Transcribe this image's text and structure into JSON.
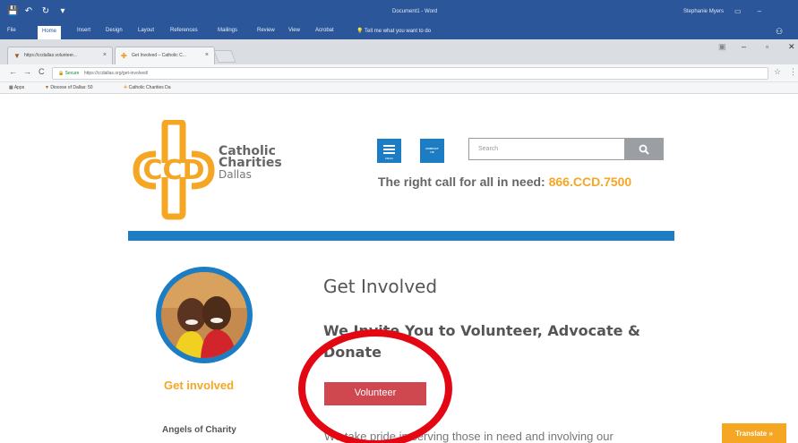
{
  "word": {
    "qat": [
      "💾",
      "↶",
      "↻",
      "▾"
    ],
    "doc_title": "Document1 - Word",
    "user": "Stephanie Myers",
    "tabs": [
      "File",
      "Home",
      "Insert",
      "Design",
      "Layout",
      "References",
      "Mailings",
      "Review",
      "View",
      "Acrobat"
    ],
    "tell_me": "Tell me what you want to do",
    "share": "Share"
  },
  "browser": {
    "tabs": [
      {
        "title": "https://ccdallas.volunteer..."
      },
      {
        "title": "Get Involved – Catholic C..."
      }
    ],
    "secure_label": "Secure",
    "url": "https://ccdallas.org/get-involved/",
    "bookmarks": [
      "Apps",
      "Diocese of Dallas: 50",
      "Catholic Charities Da"
    ]
  },
  "site": {
    "logo_letters": "CCD",
    "logo_lines": [
      "Catholic",
      "Charities",
      "Dallas"
    ],
    "menu_label": "MENU",
    "contact_label_1": "CONTACT",
    "contact_label_2": "US",
    "search_placeholder": "Search",
    "tagline": "The right call for all in need:",
    "phone": "866.CCD.7500",
    "sidebar_link": "Get involved",
    "sidebar_sub": "Angels of Charity",
    "page_title": "Get Involved",
    "subtitle": "We Invite You to Volunteer, Advocate & Donate",
    "volunteer_button": "Volunteer",
    "body_text": "We take pride in serving those in need and involving our",
    "translate_button": "Translate »"
  },
  "colors": {
    "word_blue": "#2b579a",
    "brand_blue": "#1c7dc4",
    "brand_orange": "#f5a623",
    "button_red": "#d0484f",
    "annotation_red": "#e30613"
  }
}
